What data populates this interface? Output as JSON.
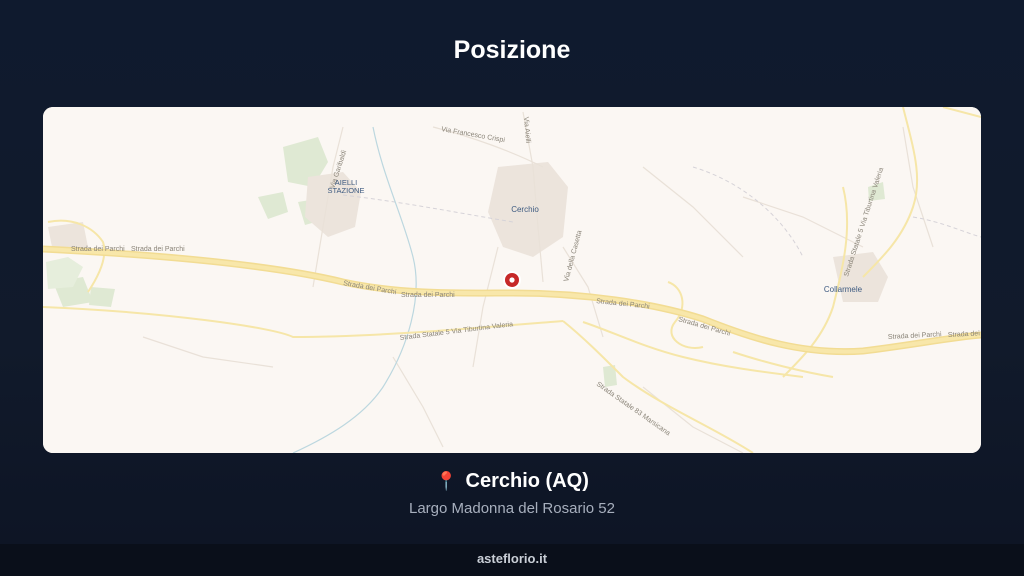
{
  "page": {
    "title": "Posizione"
  },
  "map": {
    "places": {
      "aielli": "AIELLI",
      "stazione": "STAZIONE",
      "cerchio": "Cerchio",
      "collarmele": "Collarmele"
    },
    "roads": {
      "parchi": "Strada dei Parchi",
      "tiburtina": "Strada Statale 5 Via Tiburtina Valeria",
      "tiburtina_short": "Strada Statale 5 Via Tiburtina Valeria",
      "marsicana": "Strada Statale 83 Marsicana",
      "garibaldi": "Via Garibaldi",
      "crispi": "Via Francesco Crispi",
      "aielli_road": "Via Aielli",
      "casetta": "Via della Casetta"
    },
    "marker": {
      "color": "#c62828"
    }
  },
  "location": {
    "pin_icon": "📍",
    "name": "Cerchio (AQ)",
    "address": "Largo Madonna del Rosario 52"
  },
  "footer": {
    "site": "asteflorio.it"
  }
}
